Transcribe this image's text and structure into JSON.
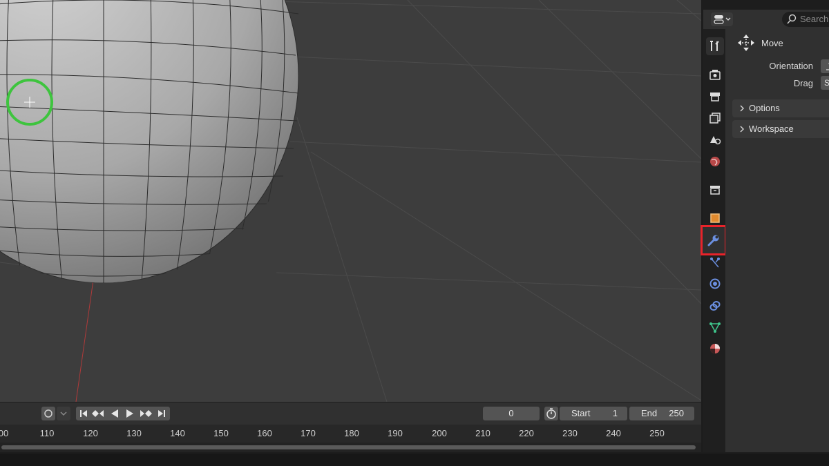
{
  "properties": {
    "search_placeholder": "Search",
    "tool_name": "Move",
    "orientation_label": "Orientation",
    "drag_label": "Drag",
    "drag_value": "S",
    "panels": [
      "Options",
      "Workspace"
    ],
    "tabs": [
      "tool-icon",
      "render-icon",
      "output-icon",
      "view-layer-icon",
      "scene-icon",
      "world-icon",
      "collection-icon",
      "object-icon",
      "modifier-wrench-icon",
      "particles-icon",
      "physics-icon",
      "constraints-icon",
      "data-icon",
      "material-icon"
    ],
    "active_tab": "modifier-wrench-icon",
    "highlight_color": "#e8232a"
  },
  "timeline": {
    "current_frame": "0",
    "start_label": "Start",
    "start_value": "1",
    "end_label": "End",
    "end_value": "250",
    "ruler_ticks": [
      "00",
      "110",
      "120",
      "130",
      "140",
      "150",
      "160",
      "170",
      "180",
      "190",
      "200",
      "210",
      "220",
      "230",
      "240",
      "250"
    ]
  }
}
